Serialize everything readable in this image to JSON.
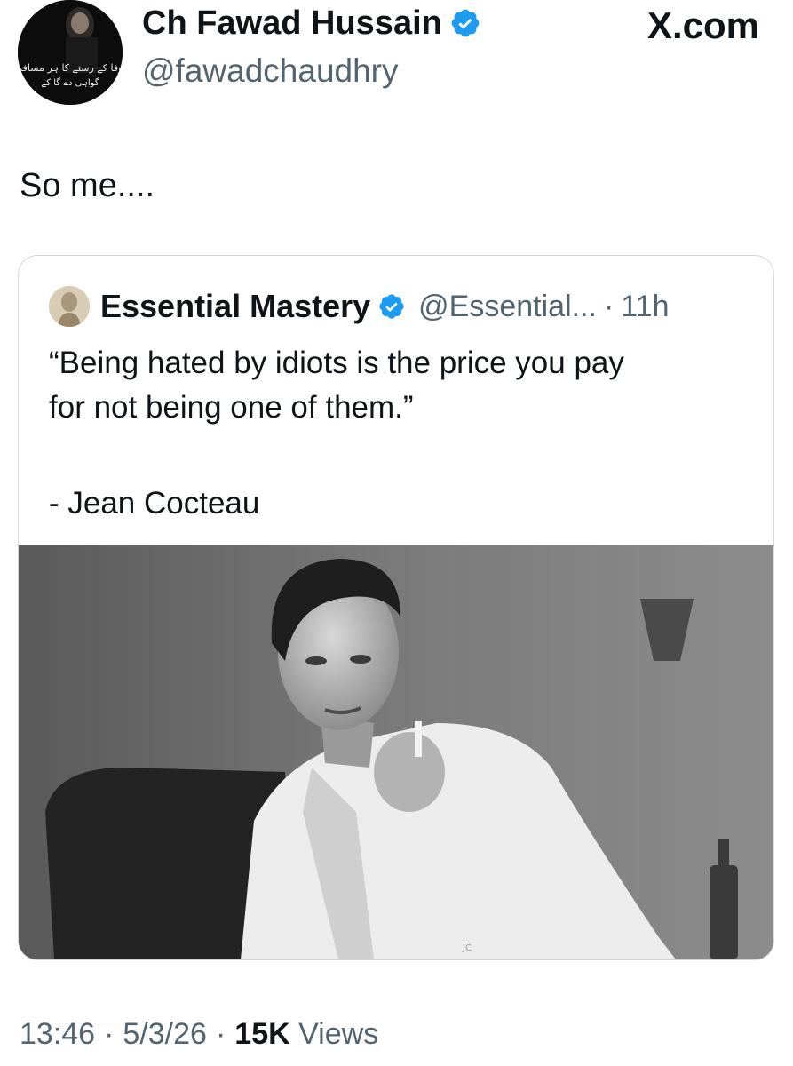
{
  "author": {
    "name": "Ch Fawad Hussain",
    "handle": "@fawadchaudhry",
    "avatar_caption": "وفا کے رستے کا ہر مسافر گواہی دے گا کے"
  },
  "brand": {
    "label": "X.com"
  },
  "tweet": {
    "text": "So me...."
  },
  "quote": {
    "name": "Essential Mastery",
    "handle": "@Essential...",
    "separator": "·",
    "time": "11h",
    "text_line1": "“Being hated by idiots is the price you pay",
    "text_line2": "for not being one of them.”",
    "attribution": "- Jean Cocteau",
    "image_signature": "JC"
  },
  "meta": {
    "time": "13:46",
    "sep1": "·",
    "date": "5/3/26",
    "sep2": "·",
    "views_count": "15K",
    "views_label": "Views"
  },
  "colors": {
    "text": "#0f1419",
    "secondary": "#536471",
    "verified_blue": "#1d9bf0",
    "border": "#cfd9de"
  },
  "icons": {
    "verified": "verified-badge-icon"
  }
}
